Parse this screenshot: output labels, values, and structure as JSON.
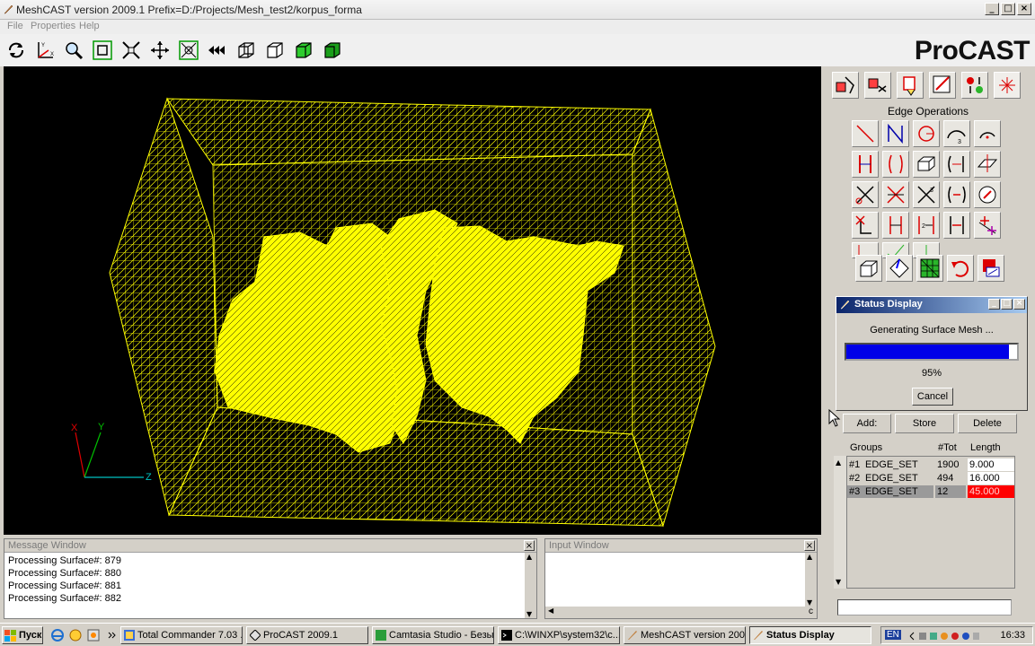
{
  "window": {
    "title": "MeshCAST version 2009.1  Prefix=D:/Projects/Mesh_test2/korpus_forma",
    "controls": [
      "_",
      "□",
      "×"
    ]
  },
  "menu": [
    "File",
    "Properties",
    "Help"
  ],
  "logo": "ProCAST",
  "toolbar_icons": [
    "rotate-icon",
    "axes-icon",
    "zoom-icon",
    "fit-icon",
    "scale-icon",
    "pan-icon",
    "pick-icon",
    "rewind-icon",
    "wire-box-icon",
    "hidden-box-icon",
    "green-box-icon",
    "green-solid-box-icon"
  ],
  "viewport": {
    "axes": {
      "x": "X",
      "y": "Y",
      "z": "Z"
    },
    "mesh_color": "#ffff00"
  },
  "edge_ops": {
    "title": "Edge Operations"
  },
  "status_display": {
    "title": "Status Display",
    "message": "Generating Surface Mesh ...",
    "progress": 0.95,
    "percent_text": "95%",
    "cancel": "Cancel"
  },
  "actions": {
    "add": "Add:",
    "store": "Store",
    "delete": "Delete"
  },
  "groups": {
    "headers": [
      "Groups",
      "#Tot",
      "Length"
    ],
    "rows": [
      {
        "id": "#1",
        "name": "EDGE_SET",
        "tot": "1900",
        "length": "9.000",
        "selected": false
      },
      {
        "id": "#2",
        "name": "EDGE_SET",
        "tot": "494",
        "length": "16.000",
        "selected": false
      },
      {
        "id": "#3",
        "name": "EDGE_SET",
        "tot": "12",
        "length": "45.000",
        "selected": true
      }
    ]
  },
  "message_window": {
    "title": "Message Window",
    "lines": [
      "Processing Surface#: 879",
      "Processing Surface#: 880",
      "Processing Surface#: 881",
      "Processing Surface#: 882"
    ]
  },
  "input_window": {
    "title": "Input Window",
    "scroll_c": "c"
  },
  "taskbar": {
    "start": "Пуск",
    "tasks": [
      "Total Commander 7.03 ...",
      "ProCAST 2009.1",
      "Camtasia Studio - Безы...",
      "C:\\WINXP\\system32\\c...",
      "MeshCAST version 200...",
      "Status Display"
    ],
    "lang": "EN",
    "clock": "16:33"
  }
}
